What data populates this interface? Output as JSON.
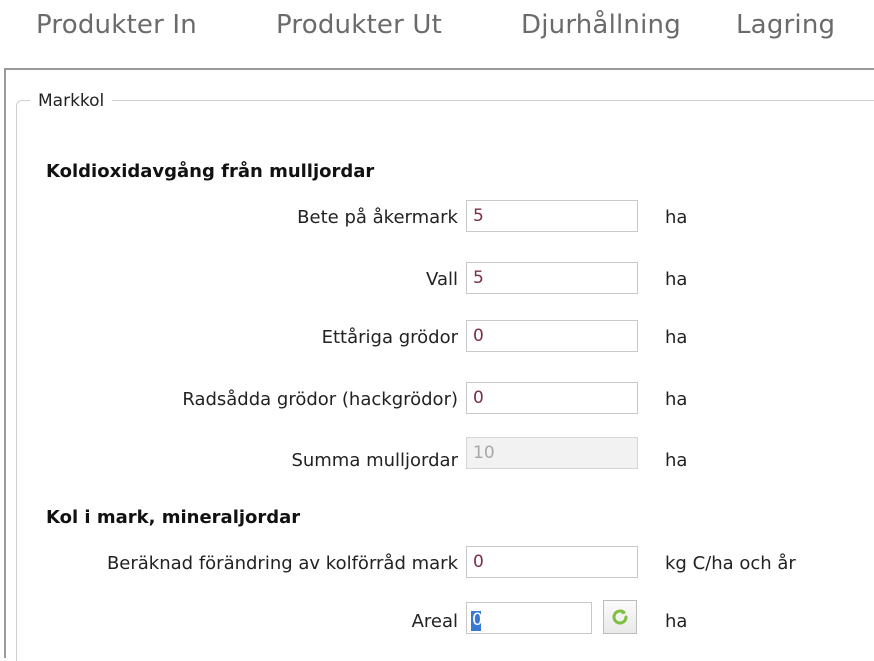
{
  "tabs": [
    {
      "label": "Produkter In"
    },
    {
      "label": "Produkter Ut"
    },
    {
      "label": "Djurhållning"
    },
    {
      "label": "Lagring"
    }
  ],
  "group": {
    "legend": "Markkol"
  },
  "section1": {
    "title": "Koldioxidavgång från mulljordar",
    "rows": [
      {
        "label": "Bete på åkermark",
        "value": "5",
        "unit": "ha"
      },
      {
        "label": "Vall",
        "value": "5",
        "unit": "ha"
      },
      {
        "label": "Ettåriga grödor",
        "value": "0",
        "unit": "ha"
      },
      {
        "label": "Radsådda grödor (hackgrödor)",
        "value": "0",
        "unit": "ha"
      },
      {
        "label": "Summa mulljordar",
        "value": "10",
        "unit": "ha"
      }
    ]
  },
  "section2": {
    "title": "Kol i mark, mineraljordar",
    "rows": [
      {
        "label": "Beräknad förändring av kolförråd mark",
        "value": "0",
        "unit": "kg C/ha och år"
      },
      {
        "label": "Areal",
        "value": "0",
        "unit": "ha"
      }
    ]
  },
  "colors": {
    "value_text": "#7a2e4a",
    "refresh_icon": "#7fbf3f",
    "selection": "#3a78d6"
  },
  "icons": {
    "refresh": "refresh-icon"
  }
}
